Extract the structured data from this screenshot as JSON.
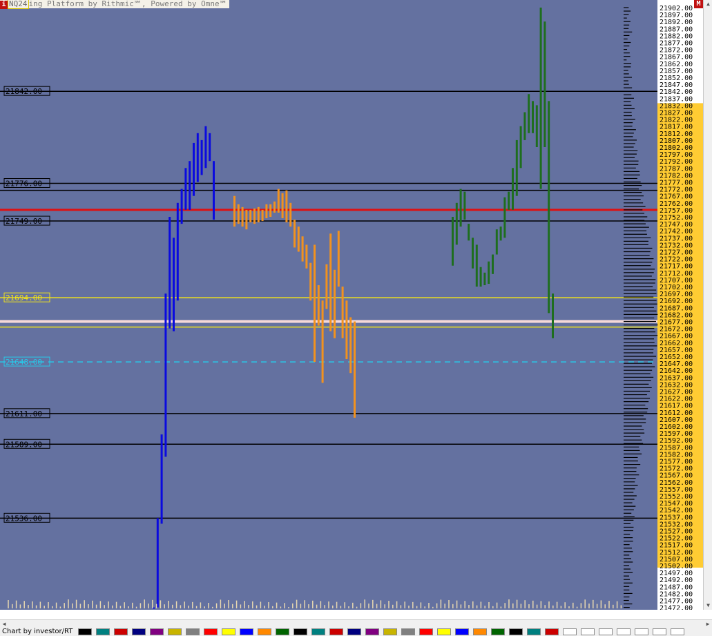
{
  "title_bar": {
    "icon_letter": "i",
    "symbol": "NQ24",
    "platform_text": "ing Platform by Rithmic℠, Powered by Omne℠"
  },
  "menu_button": "M",
  "credit": "Chart by investor/RT",
  "colors": {
    "background": "#6471a0",
    "bars_blue": "#0a0adf",
    "bars_orange": "#f2921e",
    "bars_green": "#1e6e1e",
    "line_red": "#e01010",
    "line_yellow": "#f0e21a",
    "line_cyan": "#28c8e8",
    "price_highlight": "#ffcc33"
  },
  "chart_data": {
    "type": "bar",
    "description_price_axis": "price ladder, step 5",
    "price_axis": {
      "max": 21902.0,
      "min": 21472.0,
      "step": 5,
      "highlight_range": [
        21502.0,
        21832.0
      ]
    },
    "level_lines": [
      {
        "price": 21842.0,
        "label": "21842.00",
        "color": "black"
      },
      {
        "price": 21776.0,
        "label": "21776.00",
        "color": "black"
      },
      {
        "price": 21771.0,
        "label": "",
        "color": "black"
      },
      {
        "price": 21757.0,
        "label": "",
        "color": "red"
      },
      {
        "price": 21749.0,
        "label": "21749.00",
        "color": "black"
      },
      {
        "price": 21694.0,
        "label": "21694.00",
        "color": "yellow"
      },
      {
        "price": 21677.0,
        "label": "",
        "color": "white"
      },
      {
        "price": 21673.0,
        "label": "",
        "color": "yellow"
      },
      {
        "price": 21648.0,
        "label": "21648.00",
        "color": "cyan",
        "dashed": true
      },
      {
        "price": 21611.0,
        "label": "21611.00",
        "color": "black"
      },
      {
        "price": 21589.0,
        "label": "21589.00",
        "color": "black"
      },
      {
        "price": 21536.0,
        "label": "21536.00",
        "color": "black"
      }
    ],
    "series": [
      {
        "name": "",
        "color_key": "bars_blue",
        "bars": [
          {
            "high": 21472,
            "low": 21472
          },
          {
            "high": 21536,
            "low": 21472
          },
          {
            "high": 21596,
            "low": 21532
          },
          {
            "high": 21697,
            "low": 21580
          },
          {
            "high": 21752,
            "low": 21672
          },
          {
            "high": 21737,
            "low": 21670
          },
          {
            "high": 21762,
            "low": 21692
          },
          {
            "high": 21772,
            "low": 21747
          },
          {
            "high": 21787,
            "low": 21757
          },
          {
            "high": 21792,
            "low": 21757
          },
          {
            "high": 21805,
            "low": 21767
          },
          {
            "high": 21812,
            "low": 21777
          },
          {
            "high": 21807,
            "low": 21782
          },
          {
            "high": 21817,
            "low": 21787
          },
          {
            "high": 21812,
            "low": 21792
          },
          {
            "high": 21792,
            "low": 21750
          }
        ]
      },
      {
        "name": "",
        "color_key": "bars_orange",
        "bars": [
          {
            "high": 21767,
            "low": 21745
          },
          {
            "high": 21761,
            "low": 21747
          },
          {
            "high": 21759,
            "low": 21745
          },
          {
            "high": 21757,
            "low": 21743
          },
          {
            "high": 21757,
            "low": 21748
          },
          {
            "high": 21758,
            "low": 21747
          },
          {
            "high": 21759,
            "low": 21748
          },
          {
            "high": 21757,
            "low": 21749
          },
          {
            "high": 21761,
            "low": 21751
          },
          {
            "high": 21761,
            "low": 21752
          },
          {
            "high": 21763,
            "low": 21755
          },
          {
            "high": 21772,
            "low": 21755
          },
          {
            "high": 21769,
            "low": 21751
          },
          {
            "high": 21771,
            "low": 21748
          },
          {
            "high": 21762,
            "low": 21745
          },
          {
            "high": 21750,
            "low": 21730
          },
          {
            "high": 21745,
            "low": 21727
          },
          {
            "high": 21738,
            "low": 21720
          },
          {
            "high": 21732,
            "low": 21715
          },
          {
            "high": 21719,
            "low": 21692
          },
          {
            "high": 21732,
            "low": 21648
          },
          {
            "high": 21703,
            "low": 21674
          },
          {
            "high": 21692,
            "low": 21633
          },
          {
            "high": 21718,
            "low": 21686
          },
          {
            "high": 21740,
            "low": 21670
          },
          {
            "high": 21714,
            "low": 21665
          },
          {
            "high": 21742,
            "low": 21702
          },
          {
            "high": 21702,
            "low": 21665
          },
          {
            "high": 21692,
            "low": 21650
          },
          {
            "high": 21680,
            "low": 21640
          },
          {
            "high": 21677,
            "low": 21608
          }
        ]
      },
      {
        "name": "",
        "color_key": "bars_green",
        "bars": [
          {
            "high": 21752,
            "low": 21717
          },
          {
            "high": 21762,
            "low": 21732
          },
          {
            "high": 21772,
            "low": 21745
          },
          {
            "high": 21770,
            "low": 21750
          },
          {
            "high": 21747,
            "low": 21735
          },
          {
            "high": 21737,
            "low": 21715
          },
          {
            "high": 21732,
            "low": 21702
          },
          {
            "high": 21716,
            "low": 21702
          },
          {
            "high": 21712,
            "low": 21703
          },
          {
            "high": 21720,
            "low": 21704
          },
          {
            "high": 21725,
            "low": 21711
          },
          {
            "high": 21743,
            "low": 21725
          },
          {
            "high": 21745,
            "low": 21735
          },
          {
            "high": 21766,
            "low": 21737
          },
          {
            "high": 21770,
            "low": 21757
          },
          {
            "high": 21787,
            "low": 21757
          },
          {
            "high": 21807,
            "low": 21767
          },
          {
            "high": 21817,
            "low": 21787
          },
          {
            "high": 21827,
            "low": 21807
          },
          {
            "high": 21840,
            "low": 21812
          },
          {
            "high": 21835,
            "low": 21812
          },
          {
            "high": 21832,
            "low": 21802
          },
          {
            "high": 21902,
            "low": 21772
          },
          {
            "high": 21892,
            "low": 21802
          },
          {
            "high": 21835,
            "low": 21683
          },
          {
            "high": 21697,
            "low": 21665
          }
        ]
      }
    ],
    "volume_profile_note": "horizontal volume histogram on right side",
    "grid": false
  }
}
